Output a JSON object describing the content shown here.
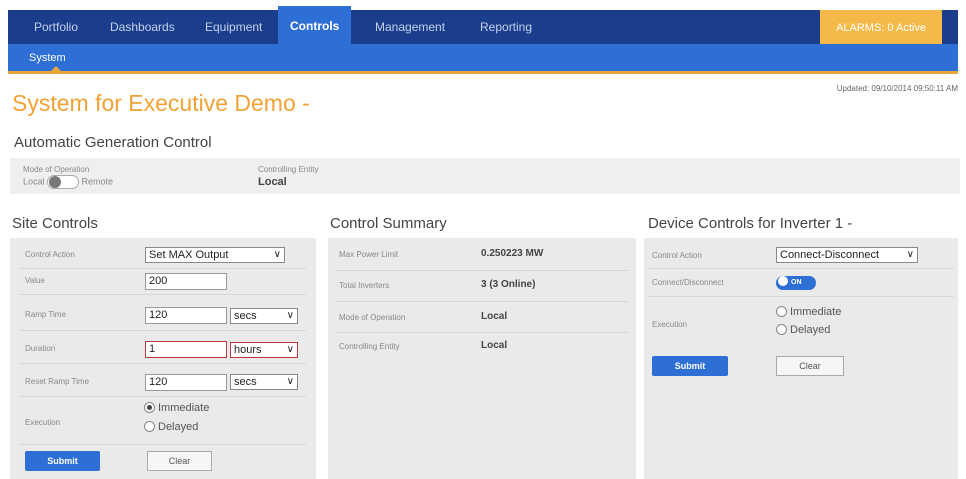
{
  "nav": {
    "tabs": [
      {
        "label": "Portfolio"
      },
      {
        "label": "Dashboards"
      },
      {
        "label": "Equipment"
      },
      {
        "label": "Controls"
      },
      {
        "label": "Management"
      },
      {
        "label": "Reporting"
      }
    ],
    "active_tab": "Controls",
    "alarms_label": "ALARMS: 0 Active",
    "subnav": {
      "label": "System"
    }
  },
  "page": {
    "updated": "Updated: 09/10/2014 09:50:11 AM",
    "title": "System for Executive Demo -",
    "section": "Automatic Generation Control"
  },
  "agc": {
    "mode_label": "Mode of Operation",
    "local_label": "Local",
    "remote_label": "Remote",
    "entity_label": "Controlling Entity",
    "entity_value": "Local"
  },
  "site_controls": {
    "title": "Site Controls",
    "control_action_label": "Control Action",
    "control_action_value": "Set MAX Output",
    "value_label": "Value",
    "value": "200",
    "ramp_label": "Ramp Time",
    "ramp_value": "120",
    "ramp_unit": "secs",
    "duration_label": "Duration",
    "duration_value": "1",
    "duration_unit": "hours",
    "reset_label": "Reset Ramp Time",
    "reset_value": "120",
    "reset_unit": "secs",
    "execution_label": "Execution",
    "immediate": "Immediate",
    "delayed": "Delayed",
    "submit": "Submit",
    "clear": "Clear"
  },
  "control_summary": {
    "title": "Control Summary",
    "rows": [
      {
        "label": "Max Power Limit",
        "value": "0.250223 MW"
      },
      {
        "label": "Total Inverters",
        "value": "3  (3 Online)"
      },
      {
        "label": "Mode of Operation",
        "value": "Local"
      },
      {
        "label": "Controlling Entity",
        "value": "Local"
      }
    ]
  },
  "device_controls": {
    "title": "Device Controls for Inverter 1 -",
    "control_action_label": "Control Action",
    "control_action_value": "Connect-Disconnect",
    "connect_label": "Connect/Disconnect",
    "toggle_label": "ON",
    "execution_label": "Execution",
    "immediate": "Immediate",
    "delayed": "Delayed",
    "submit": "Submit",
    "clear": "Clear"
  },
  "colors": {
    "nav_bg": "#1a3d8c",
    "accent_blue": "#2d6fd4",
    "accent_orange": "#f0a334",
    "alarm_bg": "#f5b94a"
  }
}
